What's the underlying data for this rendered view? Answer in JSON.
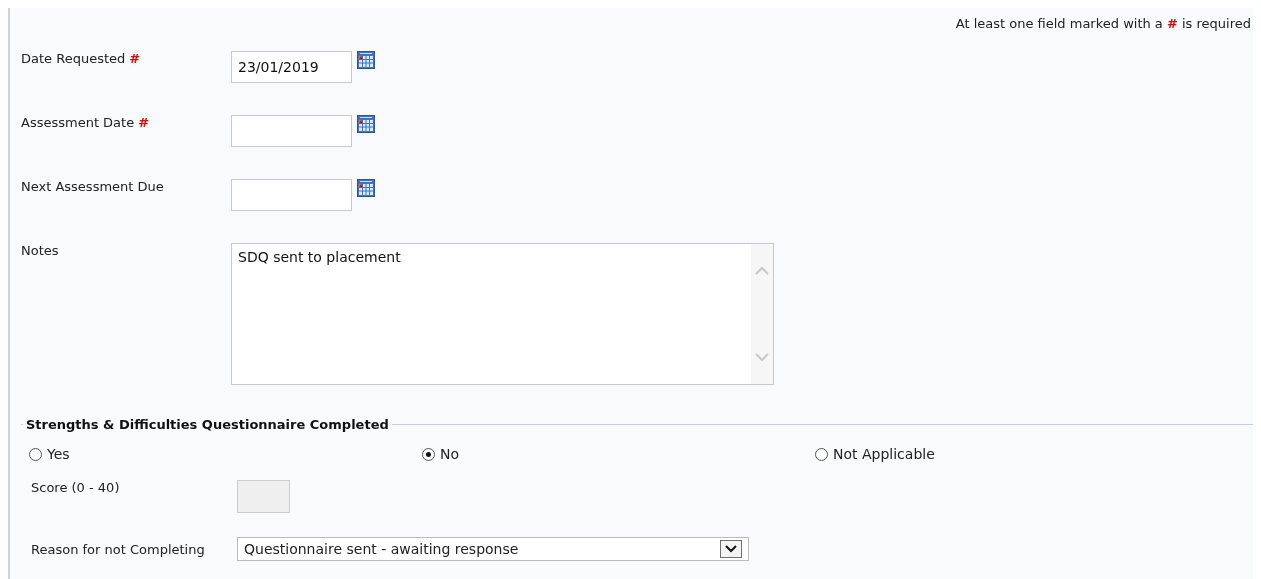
{
  "required_note": "At least one field marked with a **#** is required",
  "date_fields": [
    {
      "label": "Date Requested",
      "marker": "#",
      "value": "23/01/2019"
    },
    {
      "label": "Assessment Date",
      "marker": "#"
    },
    {
      "label": "Next Assessment Due"
    }
  ],
  "notes": {
    "label": "Notes",
    "value": "SDQ sent to placement"
  },
  "questionnaire": {
    "legend": "Strengths & Difficulties Questionnaire Completed",
    "options": [
      {
        "label": "Yes",
        "selected": false
      },
      {
        "label": "No",
        "selected": true
      },
      {
        "label": "Not Applicable",
        "selected": false
      }
    ],
    "score": {
      "label": "Score (0 - 40)",
      "disabled": true
    },
    "reason": {
      "label": "Reason for not Completing",
      "value": "Questionnaire sent - awaiting response"
    }
  }
}
